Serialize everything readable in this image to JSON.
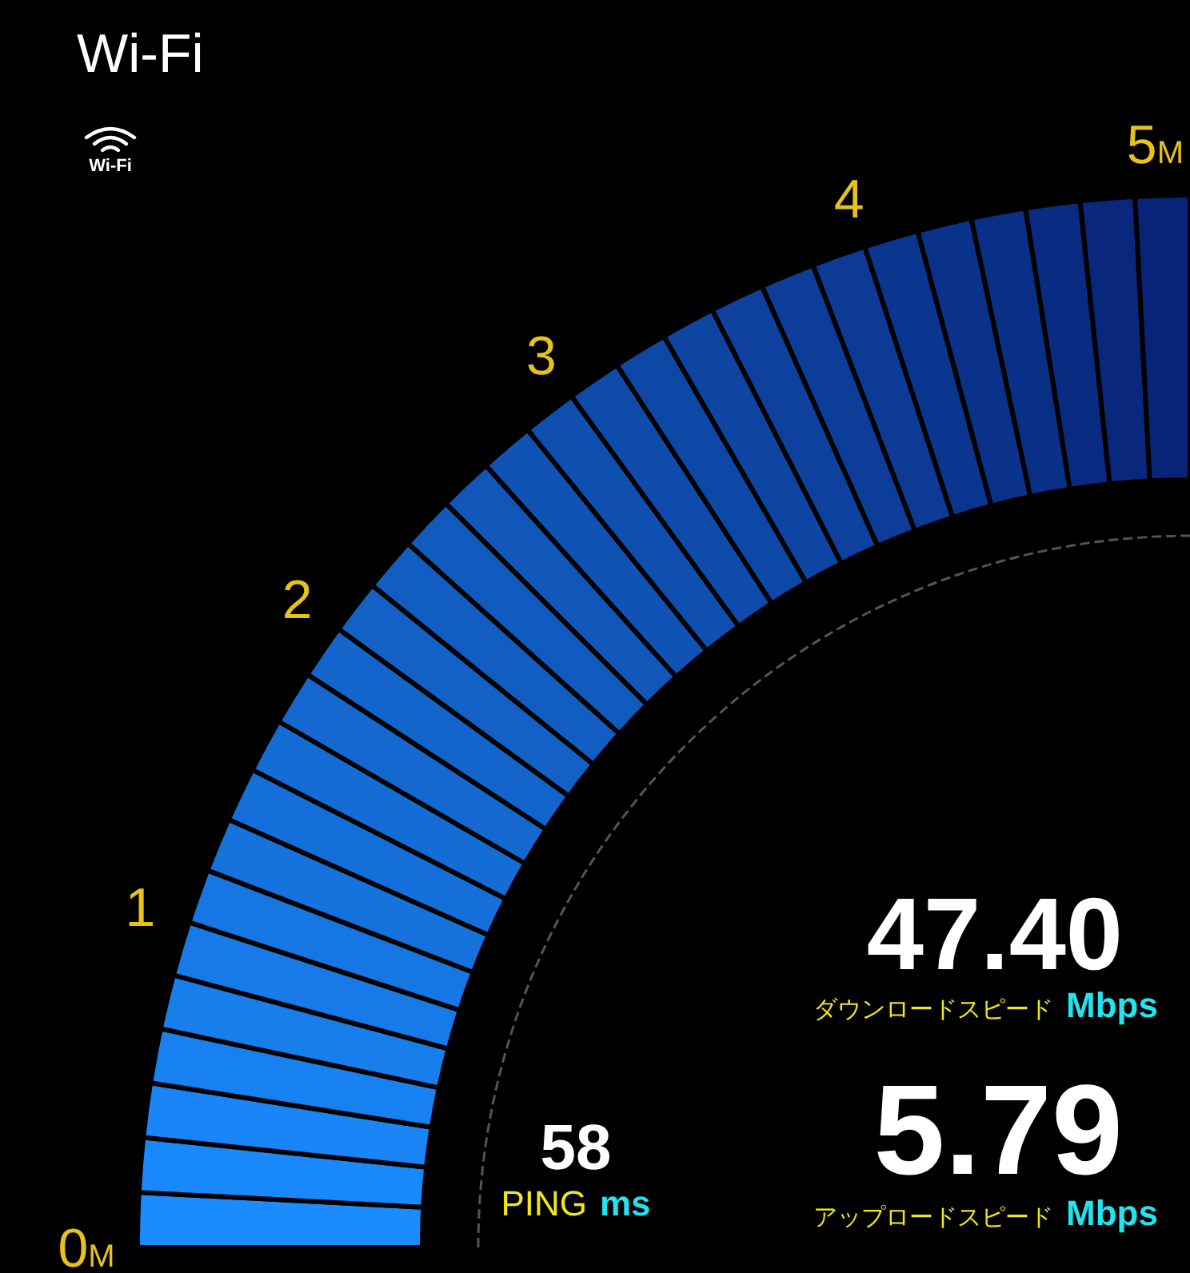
{
  "title": "Wi-Fi",
  "connection": {
    "label": "Wi-Fi"
  },
  "gauge": {
    "ticks": [
      {
        "value": "0",
        "unit": "M"
      },
      {
        "value": "1"
      },
      {
        "value": "2"
      },
      {
        "value": "3"
      },
      {
        "value": "4"
      },
      {
        "value": "5",
        "unit": "M"
      }
    ]
  },
  "download": {
    "value": "47.40",
    "label": "ダウンロードスピード",
    "unit": "Mbps"
  },
  "upload": {
    "value": "5.79",
    "label": "アップロードスピード",
    "unit": "Mbps"
  },
  "ping": {
    "value": "58",
    "label": "PING",
    "unit": "ms"
  }
}
